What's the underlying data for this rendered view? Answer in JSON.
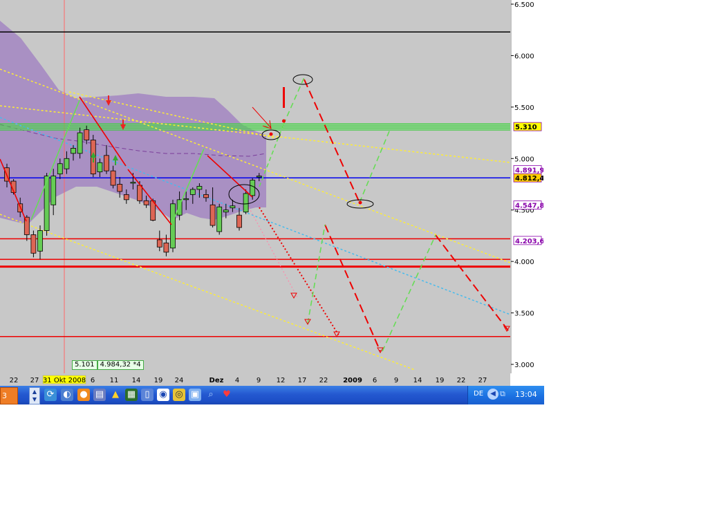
{
  "chart_data": {
    "type": "candlestick",
    "title": "",
    "y_axis": {
      "ticks": [
        "3.000",
        "3.500",
        "4.000",
        "4.500",
        "5.000",
        "5.500",
        "6.000",
        "6.500"
      ],
      "tick_values": [
        3000,
        3500,
        4000,
        4500,
        5000,
        5500,
        6000,
        6500
      ],
      "range": [
        2950,
        6550
      ],
      "side": "right"
    },
    "x_axis": {
      "ticks": [
        "22",
        "27",
        "31 Okt 2008",
        "6",
        "11",
        "14",
        "19",
        "24",
        "Dez",
        "4",
        "9",
        "12",
        "17",
        "22",
        "2009",
        "6",
        "9",
        "14",
        "19",
        "22",
        "27"
      ],
      "highlighted_tick": "31 Okt 2008",
      "bold_ticks": [
        "Dez",
        "2009"
      ]
    },
    "candles": [
      {
        "o": 4910,
        "h": 4950,
        "l": 4720,
        "c": 4780
      },
      {
        "o": 4780,
        "h": 4800,
        "l": 4650,
        "c": 4670
      },
      {
        "o": 4560,
        "h": 4620,
        "l": 4430,
        "c": 4480
      },
      {
        "o": 4430,
        "h": 4450,
        "l": 4200,
        "c": 4260
      },
      {
        "o": 4260,
        "h": 4300,
        "l": 4040,
        "c": 4080
      },
      {
        "o": 4100,
        "h": 4350,
        "l": 4020,
        "c": 4300
      },
      {
        "o": 4300,
        "h": 4860,
        "l": 4250,
        "c": 4830
      },
      {
        "o": 4550,
        "h": 4900,
        "l": 4450,
        "c": 4830
      },
      {
        "o": 4850,
        "h": 5000,
        "l": 4800,
        "c": 4950
      },
      {
        "o": 4900,
        "h": 5070,
        "l": 4850,
        "c": 5000
      },
      {
        "o": 5050,
        "h": 5130,
        "l": 4980,
        "c": 5100
      },
      {
        "o": 5050,
        "h": 5300,
        "l": 5000,
        "c": 5250
      },
      {
        "o": 5280,
        "h": 5320,
        "l": 5140,
        "c": 5180
      },
      {
        "o": 5180,
        "h": 5230,
        "l": 4820,
        "c": 4850
      },
      {
        "o": 4870,
        "h": 5000,
        "l": 4820,
        "c": 4960
      },
      {
        "o": 5030,
        "h": 5130,
        "l": 4850,
        "c": 4880
      },
      {
        "o": 4880,
        "h": 4930,
        "l": 4710,
        "c": 4740
      },
      {
        "o": 4750,
        "h": 4820,
        "l": 4620,
        "c": 4680
      },
      {
        "o": 4650,
        "h": 4700,
        "l": 4560,
        "c": 4600
      },
      {
        "o": 4760,
        "h": 4860,
        "l": 4700,
        "c": 4770
      },
      {
        "o": 4740,
        "h": 4780,
        "l": 4560,
        "c": 4590
      },
      {
        "o": 4590,
        "h": 4640,
        "l": 4520,
        "c": 4550
      },
      {
        "o": 4590,
        "h": 4610,
        "l": 4390,
        "c": 4400
      },
      {
        "o": 4210,
        "h": 4300,
        "l": 4100,
        "c": 4140
      },
      {
        "o": 4180,
        "h": 4260,
        "l": 4050,
        "c": 4090
      },
      {
        "o": 4130,
        "h": 4600,
        "l": 4090,
        "c": 4560
      },
      {
        "o": 4450,
        "h": 4680,
        "l": 4400,
        "c": 4600
      },
      {
        "o": 4600,
        "h": 4680,
        "l": 4500,
        "c": 4610
      },
      {
        "o": 4650,
        "h": 4720,
        "l": 4560,
        "c": 4700
      },
      {
        "o": 4700,
        "h": 4760,
        "l": 4620,
        "c": 4730
      },
      {
        "o": 4650,
        "h": 4700,
        "l": 4580,
        "c": 4620
      },
      {
        "o": 4550,
        "h": 4720,
        "l": 4330,
        "c": 4350
      },
      {
        "o": 4290,
        "h": 4560,
        "l": 4260,
        "c": 4530
      },
      {
        "o": 4480,
        "h": 4560,
        "l": 4420,
        "c": 4500
      },
      {
        "o": 4520,
        "h": 4600,
        "l": 4480,
        "c": 4540
      },
      {
        "o": 4450,
        "h": 4520,
        "l": 4300,
        "c": 4330
      },
      {
        "o": 4480,
        "h": 4700,
        "l": 4460,
        "c": 4660
      },
      {
        "o": 4640,
        "h": 4810,
        "l": 4600,
        "c": 4790
      },
      {
        "o": 4820,
        "h": 4860,
        "l": 4780,
        "c": 4830
      }
    ],
    "horizontal_lines": [
      {
        "value": 6230,
        "color": "#000000"
      },
      {
        "value": 5310,
        "color": "#33cc33",
        "band": true
      },
      {
        "value": 4812,
        "color": "#0000ee"
      },
      {
        "value": 4220,
        "color": "#ee0000"
      },
      {
        "value": 4020,
        "color": "#ee0000"
      },
      {
        "value": 3950,
        "color": "#ee0000",
        "thick": true
      },
      {
        "value": 3270,
        "color": "#ee0000"
      }
    ],
    "price_labels": [
      {
        "text": "5.310",
        "value": 5310,
        "bg": "#ffff00",
        "fg": "#000000"
      },
      {
        "text": "4.891,9",
        "value": 4891.9,
        "bg": "#ffffff",
        "fg": "#8800aa"
      },
      {
        "text": "4.812,43",
        "value": 4812.43,
        "bg": "#ffd000",
        "fg": "#000000"
      },
      {
        "text": "4.547,8",
        "value": 4547.8,
        "bg": "#ffffff",
        "fg": "#8800aa"
      },
      {
        "text": "4.203,6",
        "value": 4203.6,
        "bg": "#ffffff",
        "fg": "#8800aa"
      }
    ],
    "info_box": [
      "5.101",
      "4.984,32 *4"
    ],
    "colors": {
      "background": "#c8c8c8",
      "bollinger_fill": "#a58ac2",
      "bull_candle": "#66cc55",
      "bear_candle": "#dd6655",
      "trend_yellow": "#ffee33",
      "trend_cyan": "#44bbee",
      "projection_red": "#ee0000",
      "projection_green": "#66dd55"
    }
  },
  "taskbar": {
    "left_stub": "3",
    "icons": [
      "rotate-icon",
      "globe-icon",
      "firefox-icon",
      "book-icon",
      "warning-icon",
      "grid-icon",
      "document-icon",
      "media-icon",
      "camera-icon",
      "screen-icon",
      "search-icon",
      "heart-icon"
    ],
    "language": "DE",
    "clock": "13:04"
  }
}
